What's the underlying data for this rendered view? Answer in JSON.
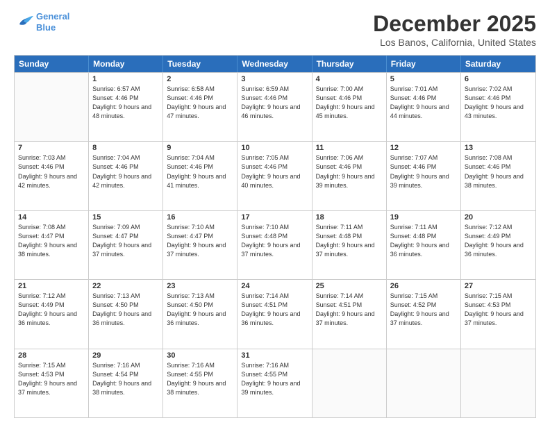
{
  "header": {
    "logo_line1": "General",
    "logo_line2": "Blue",
    "title": "December 2025",
    "subtitle": "Los Banos, California, United States"
  },
  "weekdays": [
    "Sunday",
    "Monday",
    "Tuesday",
    "Wednesday",
    "Thursday",
    "Friday",
    "Saturday"
  ],
  "weeks": [
    [
      {
        "day": "",
        "sunrise": "",
        "sunset": "",
        "daylight": ""
      },
      {
        "day": "1",
        "sunrise": "Sunrise: 6:57 AM",
        "sunset": "Sunset: 4:46 PM",
        "daylight": "Daylight: 9 hours and 48 minutes."
      },
      {
        "day": "2",
        "sunrise": "Sunrise: 6:58 AM",
        "sunset": "Sunset: 4:46 PM",
        "daylight": "Daylight: 9 hours and 47 minutes."
      },
      {
        "day": "3",
        "sunrise": "Sunrise: 6:59 AM",
        "sunset": "Sunset: 4:46 PM",
        "daylight": "Daylight: 9 hours and 46 minutes."
      },
      {
        "day": "4",
        "sunrise": "Sunrise: 7:00 AM",
        "sunset": "Sunset: 4:46 PM",
        "daylight": "Daylight: 9 hours and 45 minutes."
      },
      {
        "day": "5",
        "sunrise": "Sunrise: 7:01 AM",
        "sunset": "Sunset: 4:46 PM",
        "daylight": "Daylight: 9 hours and 44 minutes."
      },
      {
        "day": "6",
        "sunrise": "Sunrise: 7:02 AM",
        "sunset": "Sunset: 4:46 PM",
        "daylight": "Daylight: 9 hours and 43 minutes."
      }
    ],
    [
      {
        "day": "7",
        "sunrise": "Sunrise: 7:03 AM",
        "sunset": "Sunset: 4:46 PM",
        "daylight": "Daylight: 9 hours and 42 minutes."
      },
      {
        "day": "8",
        "sunrise": "Sunrise: 7:04 AM",
        "sunset": "Sunset: 4:46 PM",
        "daylight": "Daylight: 9 hours and 42 minutes."
      },
      {
        "day": "9",
        "sunrise": "Sunrise: 7:04 AM",
        "sunset": "Sunset: 4:46 PM",
        "daylight": "Daylight: 9 hours and 41 minutes."
      },
      {
        "day": "10",
        "sunrise": "Sunrise: 7:05 AM",
        "sunset": "Sunset: 4:46 PM",
        "daylight": "Daylight: 9 hours and 40 minutes."
      },
      {
        "day": "11",
        "sunrise": "Sunrise: 7:06 AM",
        "sunset": "Sunset: 4:46 PM",
        "daylight": "Daylight: 9 hours and 39 minutes."
      },
      {
        "day": "12",
        "sunrise": "Sunrise: 7:07 AM",
        "sunset": "Sunset: 4:46 PM",
        "daylight": "Daylight: 9 hours and 39 minutes."
      },
      {
        "day": "13",
        "sunrise": "Sunrise: 7:08 AM",
        "sunset": "Sunset: 4:46 PM",
        "daylight": "Daylight: 9 hours and 38 minutes."
      }
    ],
    [
      {
        "day": "14",
        "sunrise": "Sunrise: 7:08 AM",
        "sunset": "Sunset: 4:47 PM",
        "daylight": "Daylight: 9 hours and 38 minutes."
      },
      {
        "day": "15",
        "sunrise": "Sunrise: 7:09 AM",
        "sunset": "Sunset: 4:47 PM",
        "daylight": "Daylight: 9 hours and 37 minutes."
      },
      {
        "day": "16",
        "sunrise": "Sunrise: 7:10 AM",
        "sunset": "Sunset: 4:47 PM",
        "daylight": "Daylight: 9 hours and 37 minutes."
      },
      {
        "day": "17",
        "sunrise": "Sunrise: 7:10 AM",
        "sunset": "Sunset: 4:48 PM",
        "daylight": "Daylight: 9 hours and 37 minutes."
      },
      {
        "day": "18",
        "sunrise": "Sunrise: 7:11 AM",
        "sunset": "Sunset: 4:48 PM",
        "daylight": "Daylight: 9 hours and 37 minutes."
      },
      {
        "day": "19",
        "sunrise": "Sunrise: 7:11 AM",
        "sunset": "Sunset: 4:48 PM",
        "daylight": "Daylight: 9 hours and 36 minutes."
      },
      {
        "day": "20",
        "sunrise": "Sunrise: 7:12 AM",
        "sunset": "Sunset: 4:49 PM",
        "daylight": "Daylight: 9 hours and 36 minutes."
      }
    ],
    [
      {
        "day": "21",
        "sunrise": "Sunrise: 7:12 AM",
        "sunset": "Sunset: 4:49 PM",
        "daylight": "Daylight: 9 hours and 36 minutes."
      },
      {
        "day": "22",
        "sunrise": "Sunrise: 7:13 AM",
        "sunset": "Sunset: 4:50 PM",
        "daylight": "Daylight: 9 hours and 36 minutes."
      },
      {
        "day": "23",
        "sunrise": "Sunrise: 7:13 AM",
        "sunset": "Sunset: 4:50 PM",
        "daylight": "Daylight: 9 hours and 36 minutes."
      },
      {
        "day": "24",
        "sunrise": "Sunrise: 7:14 AM",
        "sunset": "Sunset: 4:51 PM",
        "daylight": "Daylight: 9 hours and 36 minutes."
      },
      {
        "day": "25",
        "sunrise": "Sunrise: 7:14 AM",
        "sunset": "Sunset: 4:51 PM",
        "daylight": "Daylight: 9 hours and 37 minutes."
      },
      {
        "day": "26",
        "sunrise": "Sunrise: 7:15 AM",
        "sunset": "Sunset: 4:52 PM",
        "daylight": "Daylight: 9 hours and 37 minutes."
      },
      {
        "day": "27",
        "sunrise": "Sunrise: 7:15 AM",
        "sunset": "Sunset: 4:53 PM",
        "daylight": "Daylight: 9 hours and 37 minutes."
      }
    ],
    [
      {
        "day": "28",
        "sunrise": "Sunrise: 7:15 AM",
        "sunset": "Sunset: 4:53 PM",
        "daylight": "Daylight: 9 hours and 37 minutes."
      },
      {
        "day": "29",
        "sunrise": "Sunrise: 7:16 AM",
        "sunset": "Sunset: 4:54 PM",
        "daylight": "Daylight: 9 hours and 38 minutes."
      },
      {
        "day": "30",
        "sunrise": "Sunrise: 7:16 AM",
        "sunset": "Sunset: 4:55 PM",
        "daylight": "Daylight: 9 hours and 38 minutes."
      },
      {
        "day": "31",
        "sunrise": "Sunrise: 7:16 AM",
        "sunset": "Sunset: 4:55 PM",
        "daylight": "Daylight: 9 hours and 39 minutes."
      },
      {
        "day": "",
        "sunrise": "",
        "sunset": "",
        "daylight": ""
      },
      {
        "day": "",
        "sunrise": "",
        "sunset": "",
        "daylight": ""
      },
      {
        "day": "",
        "sunrise": "",
        "sunset": "",
        "daylight": ""
      }
    ]
  ]
}
